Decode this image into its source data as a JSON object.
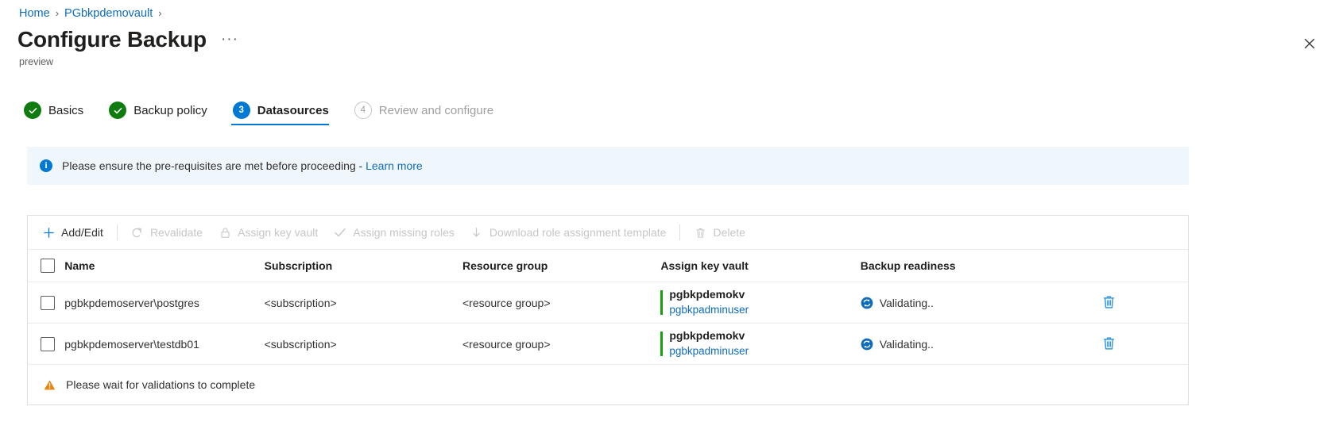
{
  "breadcrumb": {
    "items": [
      {
        "label": "Home",
        "icon": "chevron-right-icon"
      },
      {
        "label": "PGbkpdemovault",
        "icon": "chevron-right-icon"
      }
    ],
    "separator": "›"
  },
  "header": {
    "title": "Configure Backup",
    "subtitle": "preview",
    "more_label": "···",
    "close_icon": "close-icon"
  },
  "wizard": {
    "steps": [
      {
        "number": "1",
        "label": "Basics",
        "state": "done",
        "badge": "check-icon"
      },
      {
        "number": "2",
        "label": "Backup policy",
        "state": "done",
        "badge": "check-icon"
      },
      {
        "number": "3",
        "label": "Datasources",
        "state": "active",
        "badge": "3"
      },
      {
        "number": "4",
        "label": "Review and configure",
        "state": "pending",
        "badge": "4"
      }
    ]
  },
  "info_banner": {
    "icon": "info-icon",
    "glyph": "i",
    "text": "Please ensure the pre-requisites are met before proceeding - ",
    "link": "Learn more"
  },
  "toolbar": {
    "commands": [
      {
        "label": "Add/Edit",
        "icon": "plus-icon",
        "enabled": true
      },
      {
        "label": "Revalidate",
        "icon": "refresh-icon",
        "enabled": false
      },
      {
        "label": "Assign key vault",
        "icon": "lock-icon",
        "enabled": false
      },
      {
        "label": "Assign missing roles",
        "icon": "check-icon",
        "enabled": false
      },
      {
        "label": "Download role assignment template",
        "icon": "download-icon",
        "enabled": false
      },
      {
        "label": "Delete",
        "icon": "trash-icon",
        "enabled": false
      }
    ]
  },
  "table": {
    "select_all_label": "select-all-checkbox",
    "columns": [
      "Name",
      "Subscription",
      "Resource group",
      "Assign key vault",
      "Backup readiness"
    ],
    "rows": [
      {
        "name": "pgbkpdemoserver\\postgres",
        "subscription": "<subscription>",
        "resource_group": "<resource group>",
        "key_vault": "pgbkpdemokv",
        "key_vault_user": "pgbkpadminuser",
        "readiness": "Validating..",
        "readiness_icon": "sync-icon",
        "delete_icon": "trash-icon"
      },
      {
        "name": "pgbkpdemoserver\\testdb01",
        "subscription": "<subscription>",
        "resource_group": "<resource group>",
        "key_vault": "pgbkpdemokv",
        "key_vault_user": "pgbkpadminuser",
        "readiness": "Validating..",
        "readiness_icon": "sync-icon",
        "delete_icon": "trash-icon"
      }
    ]
  },
  "footer": {
    "icon": "warning-icon",
    "text": "Please wait for validations to complete"
  },
  "colors": {
    "accent": "#0078d4",
    "link": "#0f6cbd",
    "success": "#107c10",
    "keyvault_bar": "#13a10e",
    "warning": "#e8820c",
    "info_bg": "#eff6fc",
    "delete": "#3b9ae1"
  }
}
